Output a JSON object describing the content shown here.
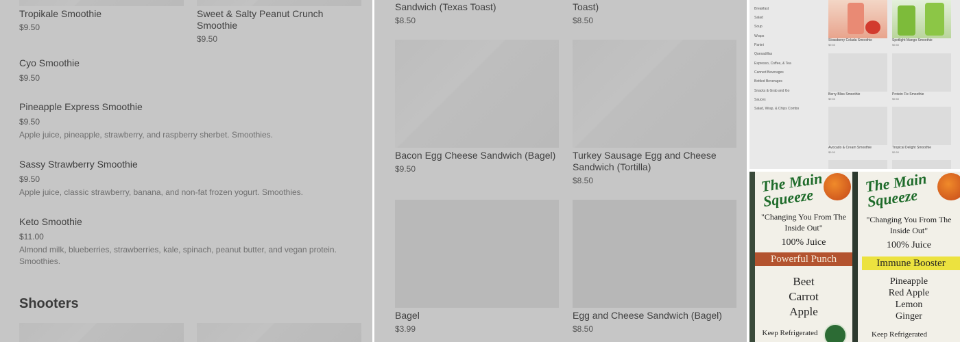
{
  "panel1": {
    "items": [
      {
        "name": "Tropikale Smoothie",
        "price": "$9.50"
      },
      {
        "name": "Sweet & Salty Peanut Crunch Smoothie",
        "price": "$9.50"
      },
      {
        "name": "Cyo Smoothie",
        "price": "$9.50"
      },
      {
        "name": "Pineapple Express Smoothie",
        "price": "$9.50",
        "desc": "Apple juice, pineapple, strawberry, and raspberry sherbet. Smoothies."
      },
      {
        "name": "Sassy Strawberry Smoothie",
        "price": "$9.50",
        "desc": "Apple juice, classic strawberry, banana, and non-fat frozen yogurt. Smoothies."
      },
      {
        "name": "Keto Smoothie",
        "price": "$11.00",
        "desc": "Almond milk, blueberries, strawberries, kale, spinach, peanut butter, and vegan protein. Smoothies."
      }
    ],
    "section_heading": "Shooters"
  },
  "panel2": {
    "items": [
      {
        "name": "Sandwich (Texas Toast)",
        "price": "$8.50"
      },
      {
        "name": "Toast)",
        "price": "$8.50"
      },
      {
        "name": "Bacon Egg Cheese Sandwich (Bagel)",
        "price": "$9.50"
      },
      {
        "name": "Turkey Sausage Egg and Cheese Sandwich (Tortilla)",
        "price": "$8.50"
      },
      {
        "name": "Bagel",
        "price": "$3.99"
      },
      {
        "name": "Egg and Cheese Sandwich (Bagel)",
        "price": "$8.50"
      }
    ]
  },
  "panel3": {
    "sidebar": [
      "Breakfast",
      "Salad",
      "Soup",
      "Wraps",
      "Panini",
      "Quesadillas",
      "Espresso, Coffee, & Tea",
      "Canned Beverages",
      "Bottled Beverages",
      "Snacks & Grab and Go",
      "Sauces",
      "Salad, Wrap, & Chips Combo"
    ],
    "products": [
      {
        "name": "Strawberry Colada Smoothie",
        "price": "$9.50"
      },
      {
        "name": "Spotlight Mango Smoothie",
        "price": "$9.50"
      },
      {
        "name": "Berry Bliss Smoothie",
        "price": "$9.50"
      },
      {
        "name": "Protein Fix Smoothie",
        "price": "$9.50"
      },
      {
        "name": "Avocado & Cream Smoothie",
        "price": "$9.50"
      },
      {
        "name": "Tropical Delight Smoothie",
        "price": "$9.50"
      }
    ]
  },
  "panel4": {
    "bottles": [
      {
        "brand": "The Main Squeeze",
        "tagline": "\"Changing You From The Inside Out\"",
        "juice": "100% Juice",
        "variety": "Powerful Punch",
        "band_color": "#b3532f",
        "ingredients": [
          "Beet",
          "Carrot",
          "Apple"
        ],
        "note": "Keep Refrigerated"
      },
      {
        "brand": "The Main Squeeze",
        "tagline": "\"Changing You From The Inside Out\"",
        "juice": "100% Juice",
        "variety": "Immune Booster",
        "band_color": "#ece23f",
        "ingredients": [
          "Pineapple",
          "Red Apple",
          "Lemon",
          "Ginger"
        ],
        "note": "Keep Refrigerated"
      }
    ]
  }
}
